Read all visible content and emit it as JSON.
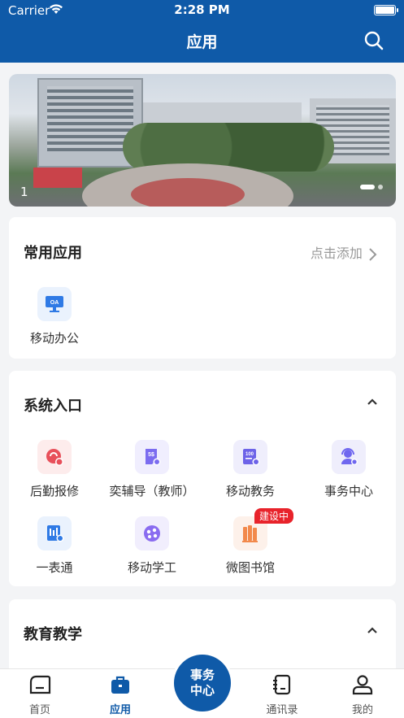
{
  "status": {
    "carrier": "Carrier",
    "time": "2:28 PM"
  },
  "header": {
    "title": "应用"
  },
  "banner": {
    "page_number": "1",
    "page_count": 2,
    "current_page": 1
  },
  "common": {
    "title": "常用应用",
    "add_label": "点击添加",
    "apps": [
      {
        "label": "移动办公",
        "icon": "oa-monitor-icon",
        "color": "#2f7ae5"
      }
    ]
  },
  "system": {
    "title": "系统入口",
    "apps": [
      {
        "label": "后勤报修",
        "icon": "repair-icon",
        "color": "#e8505b"
      },
      {
        "label": "奕辅导（教师）",
        "icon": "tutor-icon",
        "color": "#7b6cf0"
      },
      {
        "label": "移动教务",
        "icon": "academic-icon",
        "color": "#6d63e8"
      },
      {
        "label": "事务中心",
        "icon": "service-icon",
        "color": "#6f67ef"
      },
      {
        "label": "一表通",
        "icon": "form-icon",
        "color": "#2f7ae5"
      },
      {
        "label": "移动学工",
        "icon": "student-work-icon",
        "color": "#8a6cf0"
      },
      {
        "label": "微图书馆",
        "icon": "library-icon",
        "color": "#f2894b",
        "badge": "建设中"
      }
    ]
  },
  "education": {
    "title": "教育教学"
  },
  "tabbar": {
    "home": "首页",
    "apps": "应用",
    "center": "事务中心",
    "contacts": "通讯录",
    "me": "我的"
  },
  "colors": {
    "brand": "#0f5aa8",
    "badge": "#e8232b"
  }
}
